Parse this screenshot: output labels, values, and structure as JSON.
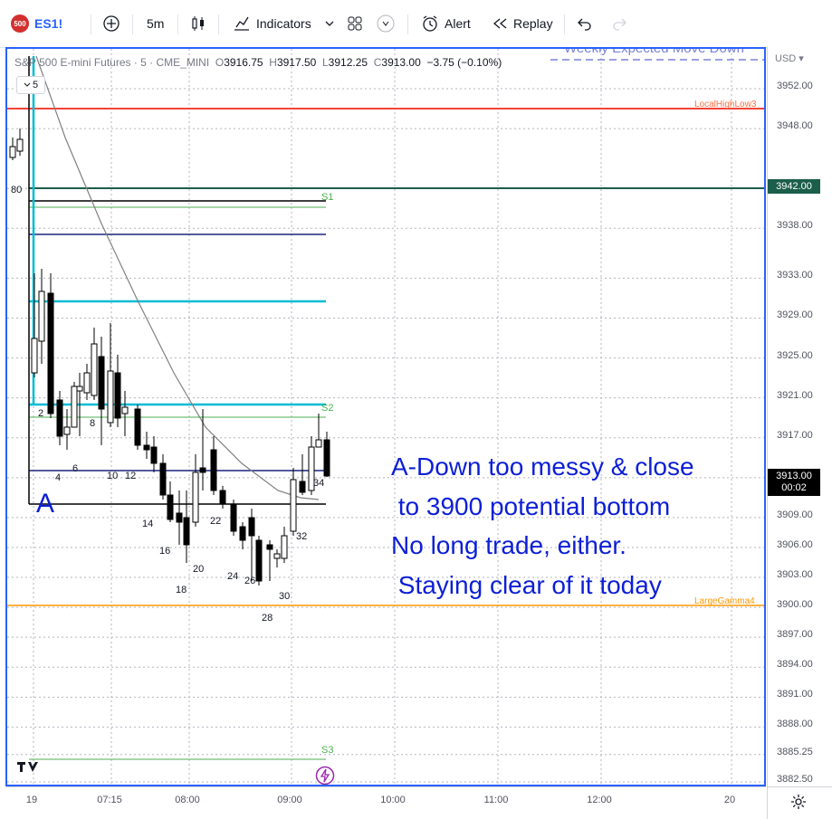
{
  "toolbar": {
    "symbol": "ES1!",
    "logo": "500",
    "interval": "5m",
    "indicators": "Indicators",
    "alert": "Alert",
    "replay": "Replay"
  },
  "legend": {
    "title": "S&P 500 E-mini Futures · 5 · CME_MINI",
    "open": "3916.75",
    "high": "3917.50",
    "low": "3912.25",
    "close": "3913.00",
    "change": "−3.75 (−0.10%)",
    "interval_chip": "5",
    "top_label": "Weekly Expected Move Down"
  },
  "axis": {
    "currency": "USD",
    "price_ticks": [
      "3952.00",
      "3948.00",
      "3942.00",
      "3938.00",
      "3933.00",
      "3929.00",
      "3925.00",
      "3921.00",
      "3917.00",
      "3913.00",
      "3909.00",
      "3906.00",
      "3903.00",
      "3900.00",
      "3897.00",
      "3894.00",
      "3891.00",
      "3888.00",
      "3885.25",
      "3882.50"
    ],
    "time_ticks": [
      "19",
      "07:15",
      "08:00",
      "09:00",
      "10:00",
      "11:00",
      "12:00",
      "20"
    ],
    "price_badge_1": "3942.00",
    "price_badge_2": "3913.00",
    "price_badge_2_timer": "00:02"
  },
  "levels": {
    "s1": "S1",
    "s2": "S2",
    "s3": "S3",
    "red_label": "LocalHighLow3",
    "orange_label": "LargeGamma4",
    "left_80": "80"
  },
  "bar_numbers": [
    "2",
    "4",
    "6",
    "8",
    "10",
    "12",
    "14",
    "16",
    "18",
    "20",
    "22",
    "24",
    "26",
    "28",
    "30",
    "32",
    "34"
  ],
  "annotation": {
    "letter": "A",
    "lines": [
      "A-Down too messy & close",
      " to 3900 potential bottom",
      "No long trade, either.",
      " Staying clear of it today"
    ]
  },
  "colors": {
    "accent": "#2962ff",
    "up_candle": "#ffffff",
    "down_candle": "#000000",
    "note_text": "#0c1fd6",
    "cyan_level": "#00bcd4",
    "red_level": "#f44336",
    "orange_level": "#ff9800"
  }
}
